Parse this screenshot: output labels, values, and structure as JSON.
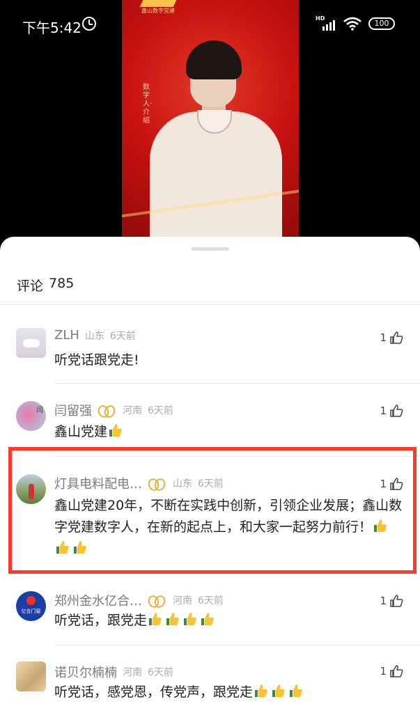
{
  "status_bar": {
    "time": "下午5:42",
    "network": "HD",
    "battery": "100"
  },
  "video": {
    "logo_text": "鑫山数字党建",
    "vertical_caption": "数字人·介绍"
  },
  "comments_header": {
    "label": "评论",
    "count": "785"
  },
  "comments": [
    {
      "name": "ZLH",
      "badge": false,
      "region": "山东",
      "time": "6天前",
      "likes": "1",
      "text": "听党话跟党走!",
      "thumbs": 0
    },
    {
      "name": "闫留强",
      "badge": true,
      "region": "河南",
      "time": "6天前",
      "likes": "1",
      "text": "鑫山党建",
      "thumbs": 1
    },
    {
      "name": "灯具电料配电…",
      "badge": true,
      "region": "山东",
      "time": "6天前",
      "likes": "1",
      "text": "鑫山党建20年，不断在实践中创新，引领企业发展；鑫山数字党建数字人，在新的起点上，和大家一起努力前行！",
      "thumbs": 3,
      "highlighted": true
    },
    {
      "name": "郑州金水亿合…",
      "badge": true,
      "region": "河南",
      "time": "6天前",
      "likes": "1",
      "text": "听党话，跟党走",
      "thumbs": 4,
      "avatar_text": "亿合门窗"
    },
    {
      "name": "诺贝尔楠楠",
      "badge": false,
      "region": "河南",
      "time": "6天前",
      "likes": "1",
      "text": "听党话，感党恩，传党声，跟党走",
      "thumbs": 3
    }
  ],
  "colors": {
    "highlight_border": "#ff3a2a",
    "badge_gold": "#e4b13d",
    "video_red": "#c8120f"
  }
}
